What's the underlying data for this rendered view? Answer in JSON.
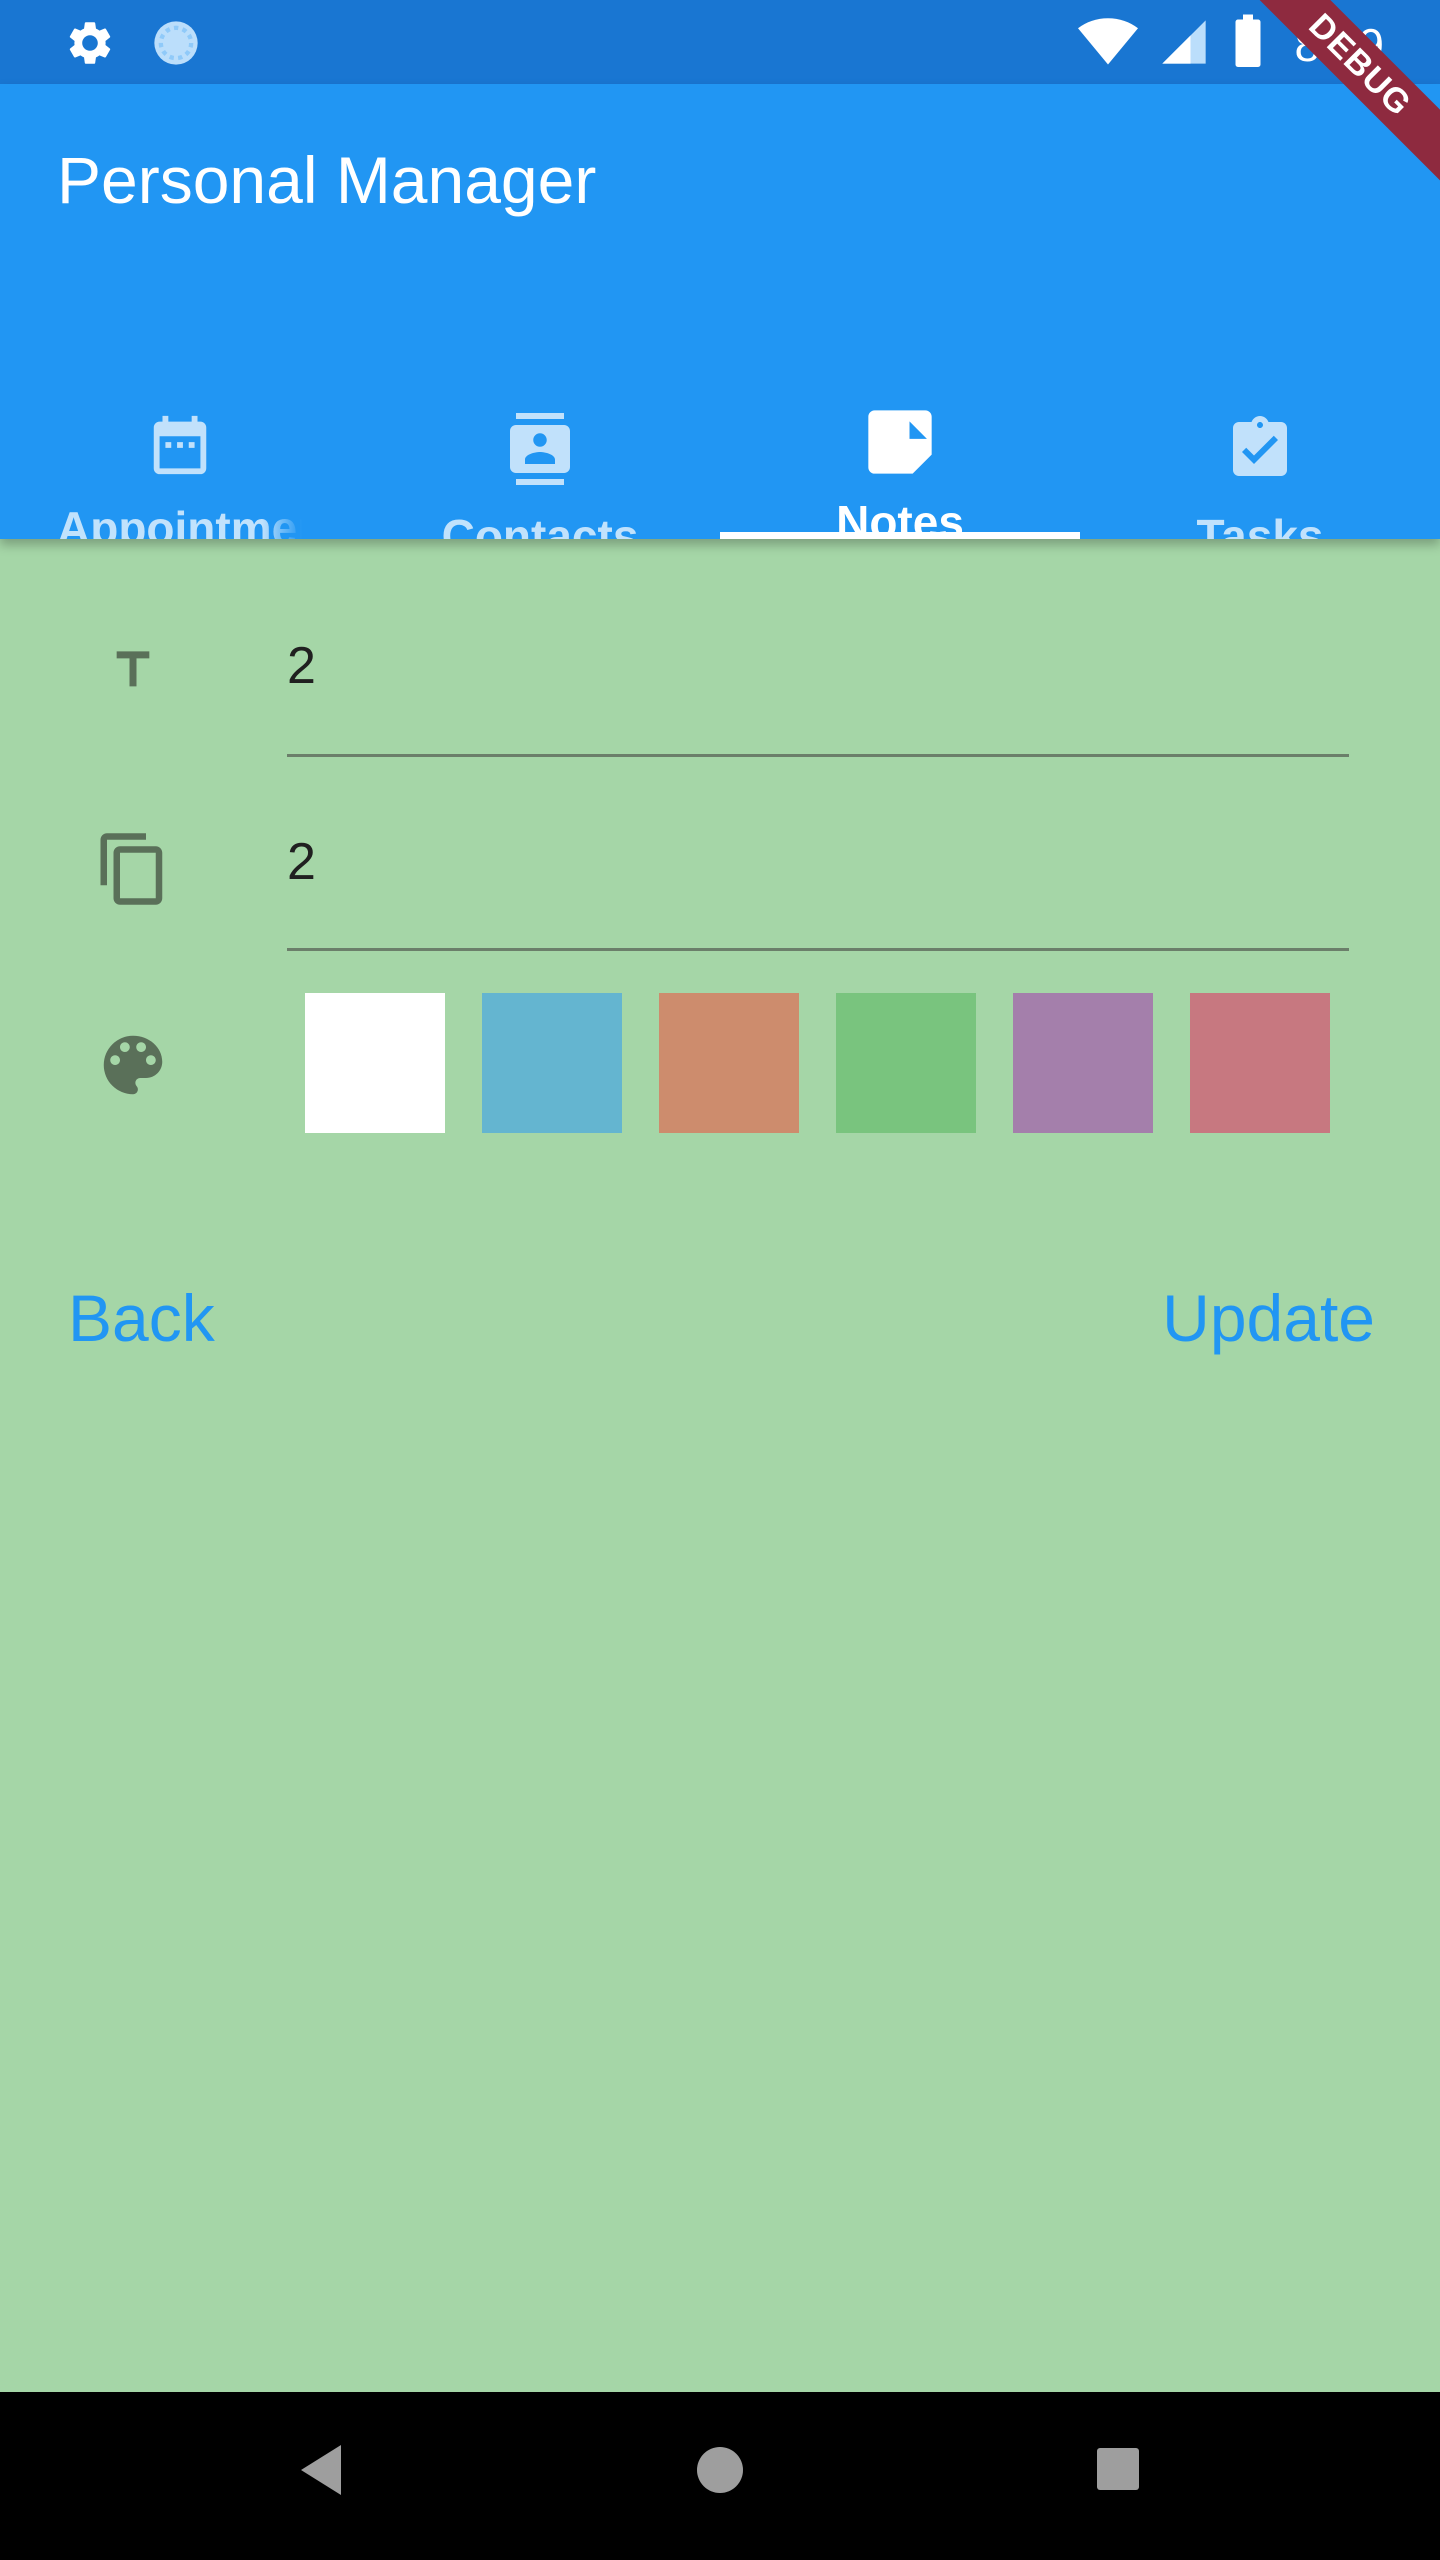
{
  "status_bar": {
    "time": "8:29",
    "icons": [
      "settings-icon",
      "sync-icon",
      "wifi-icon",
      "signal-icon",
      "battery-icon"
    ]
  },
  "app_bar": {
    "title": "Personal Manager",
    "color": "#2196F3"
  },
  "tabs": [
    {
      "label": "Appointments",
      "icon": "calendar-icon",
      "active": false
    },
    {
      "label": "Contacts",
      "icon": "contact-card-icon",
      "active": false
    },
    {
      "label": "Notes",
      "icon": "note-icon",
      "active": true
    },
    {
      "label": "Tasks",
      "icon": "clipboard-check-icon",
      "active": false
    }
  ],
  "debug_banner": "DEBUG",
  "form": {
    "title_value": "2",
    "content_value": "2",
    "colors": [
      {
        "name": "white",
        "hex": "#FFFFFF"
      },
      {
        "name": "blue",
        "hex": "#64B5D0"
      },
      {
        "name": "orange",
        "hex": "#CD8C6D"
      },
      {
        "name": "green",
        "hex": "#79C47E"
      },
      {
        "name": "purple",
        "hex": "#A47FAB"
      },
      {
        "name": "red",
        "hex": "#C77880"
      }
    ],
    "background": "#A5D6A7"
  },
  "actions": {
    "back_label": "Back",
    "update_label": "Update"
  },
  "nav_bar": {
    "buttons": [
      "back-nav-icon",
      "home-nav-icon",
      "recents-nav-icon"
    ]
  }
}
